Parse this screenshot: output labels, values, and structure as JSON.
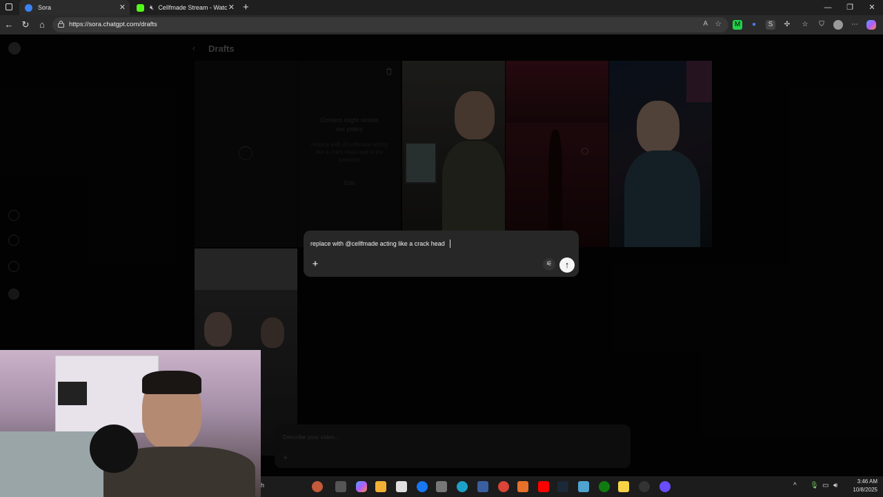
{
  "browser": {
    "tabs": [
      {
        "label": "Sora",
        "active": true
      },
      {
        "label": "Cellfmade Stream - Watch Li",
        "active": false
      }
    ],
    "url": "https://sora.chatgpt.com/drafts"
  },
  "page": {
    "title": "Drafts",
    "policy_card": {
      "title": "Content might violate our policy",
      "description": "replace with @cellfmade acting like a crack head and in the sweaters",
      "edit_label": "Edit"
    }
  },
  "composer": {
    "prompt_text": "replace with @cellfmade acting like a crack head",
    "add_label": "+",
    "send_label": "↑"
  },
  "describe_bar": {
    "placeholder": "Describe your video..."
  },
  "taskbar": {
    "search_fragment": "h",
    "time": "3:46 AM",
    "date": "10/8/2025"
  },
  "colors": {
    "page_bg": "#040404",
    "composer_bg": "#272727",
    "send_button": "#f5f5f5"
  }
}
